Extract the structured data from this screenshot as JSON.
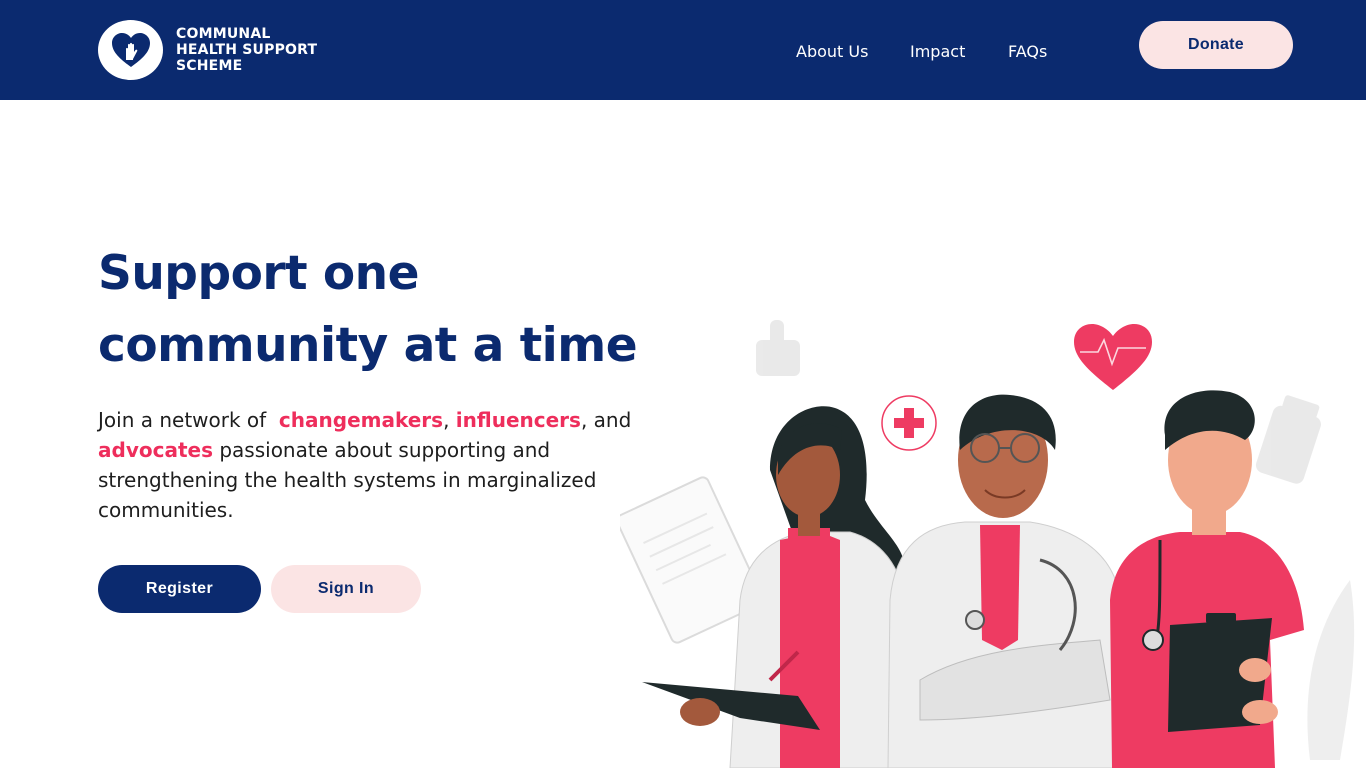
{
  "header": {
    "brand": {
      "line1": "COMMUNAL",
      "line2": "HEALTH SUPPORT",
      "line3": "SCHEME",
      "logo_icon": "heart-hand-icon"
    },
    "nav": [
      {
        "label": "About Us"
      },
      {
        "label": "Impact"
      },
      {
        "label": "FAQs"
      }
    ],
    "donate_label": "Donate"
  },
  "hero": {
    "title_line1": "Support one",
    "title_line2": "community at a time",
    "intro": "Join a network of",
    "highlight1": "changemakers",
    "sep1": ",",
    "highlight2": "influencers",
    "sep2": ", and",
    "highlight3": "advocates",
    "rest": "passionate about supporting and strengthening the health systems in marginalized communities.",
    "register_label": "Register",
    "signin_label": "Sign In"
  },
  "colors": {
    "navy": "#0b2a6f",
    "accent_pink": "#ee2e5c",
    "soft_pink": "#fbe4e4"
  }
}
